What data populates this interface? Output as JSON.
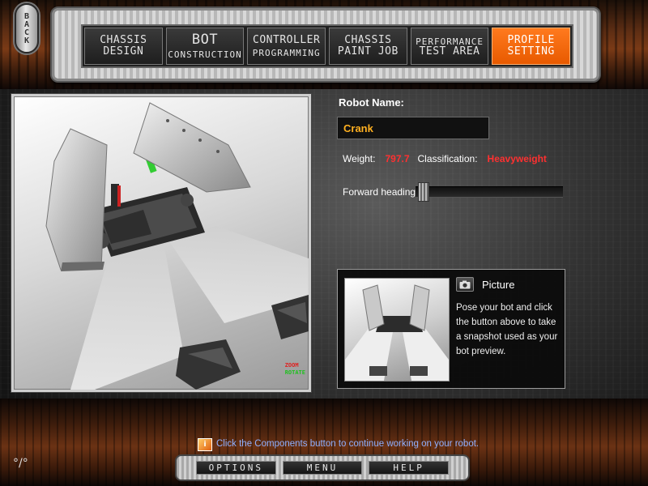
{
  "back_button": {
    "label": "BACK"
  },
  "nav_tabs": [
    {
      "line1": "CHASSIS",
      "line2": "DESIGN",
      "active": false
    },
    {
      "line1": "BOT",
      "line2": "CONSTRUCTION",
      "active": false
    },
    {
      "line1": "CONTROLLER",
      "line2": "PROGRAMMING",
      "active": false
    },
    {
      "line1": "CHASSIS",
      "line2": "PAINT JOB",
      "active": false
    },
    {
      "line1": "PERFORMANCE",
      "line2": "TEST AREA",
      "active": false
    },
    {
      "line1": "PROFILE",
      "line2": "SETTING",
      "active": true
    }
  ],
  "viewport": {
    "hint_zoom": "ZOOM",
    "hint_rotate": "ROTATE"
  },
  "robot_info": {
    "name_label": "Robot Name:",
    "name_value": "Crank",
    "weight_label": "Weight:",
    "weight_value": "797.7",
    "classification_label": "Classification:",
    "classification_value": "Heavyweight",
    "heading_label": "Forward heading:",
    "heading_fraction": 0.02
  },
  "picture_panel": {
    "title": "Picture",
    "description": "Pose your bot and click the button above to take a snapshot used as your bot preview."
  },
  "status_bar": {
    "message": "Click the Components button to continue working on your robot."
  },
  "bottom_menu": [
    "OPTIONS",
    "MENU",
    "HELP"
  ],
  "colors": {
    "accent": "#ff6a0a",
    "value_red": "#ff3030",
    "name_gold": "#ffb020",
    "status_blue": "#8fb0ff"
  },
  "icons": {
    "camera": "camera-icon",
    "status": "info-icon"
  }
}
